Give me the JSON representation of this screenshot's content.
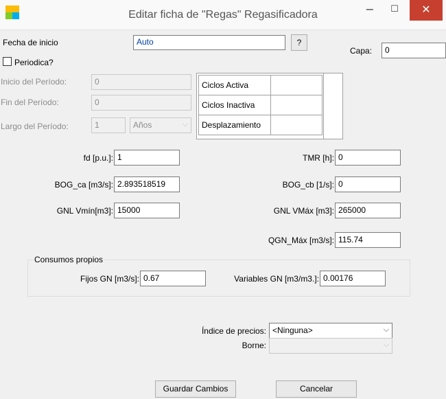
{
  "window": {
    "title": "Editar ficha de  \"Regas\" Regasificadora",
    "minimize": "−",
    "maximize": "☐",
    "close": "✕"
  },
  "top": {
    "fecha_label": "Fecha de inicio",
    "fecha_value": "Auto",
    "help_label": "?",
    "capa_label": "Capa:",
    "capa_value": "0",
    "periodica_label": "Periodica?"
  },
  "period": {
    "inicio_label": "Inicio del Período:",
    "inicio_value": "0",
    "fin_label": "Fin del Período:",
    "fin_value": "0",
    "largo_label": "Largo del Período:",
    "largo_value": "1",
    "unit_value": "Años"
  },
  "cycles": {
    "rows": [
      "Ciclos Activa",
      "Ciclos Inactiva",
      "Desplazamiento"
    ]
  },
  "params": {
    "fd_label": "fd [p.u.]:",
    "fd_value": "1",
    "tmr_label": "TMR [h]:",
    "tmr_value": "0",
    "bog_ca_label": "BOG_ca [m3/s]:",
    "bog_ca_value": "2.893518519",
    "bog_cb_label": "BOG_cb [1/s]:",
    "bog_cb_value": "0",
    "gnl_vmin_label": "GNL Vmín[m3]:",
    "gnl_vmin_value": "15000",
    "gnl_vmax_label": "GNL VMáx [m3]:",
    "gnl_vmax_value": "265000",
    "qgn_max_label": "QGN_Máx [m3/s]:",
    "qgn_max_value": "115.74"
  },
  "consumos": {
    "legend": "Consumos propios",
    "fijos_label": "Fijos GN [m3/s]:",
    "fijos_value": "0.67",
    "variables_label": "Variables GN [m3/m3.]:",
    "variables_value": "0.00176"
  },
  "precios": {
    "indice_label": "Índice de precios:",
    "indice_value": "<Ninguna>",
    "borne_label": "Borne:",
    "borne_value": ""
  },
  "actions": {
    "save_label": "Guardar Cambios",
    "cancel_label": "Cancelar"
  },
  "colors": {
    "accent": "#c7402f",
    "icon_colors": [
      "#f1511b",
      "#80cc28",
      "#00adef",
      "#fbbc09"
    ]
  }
}
